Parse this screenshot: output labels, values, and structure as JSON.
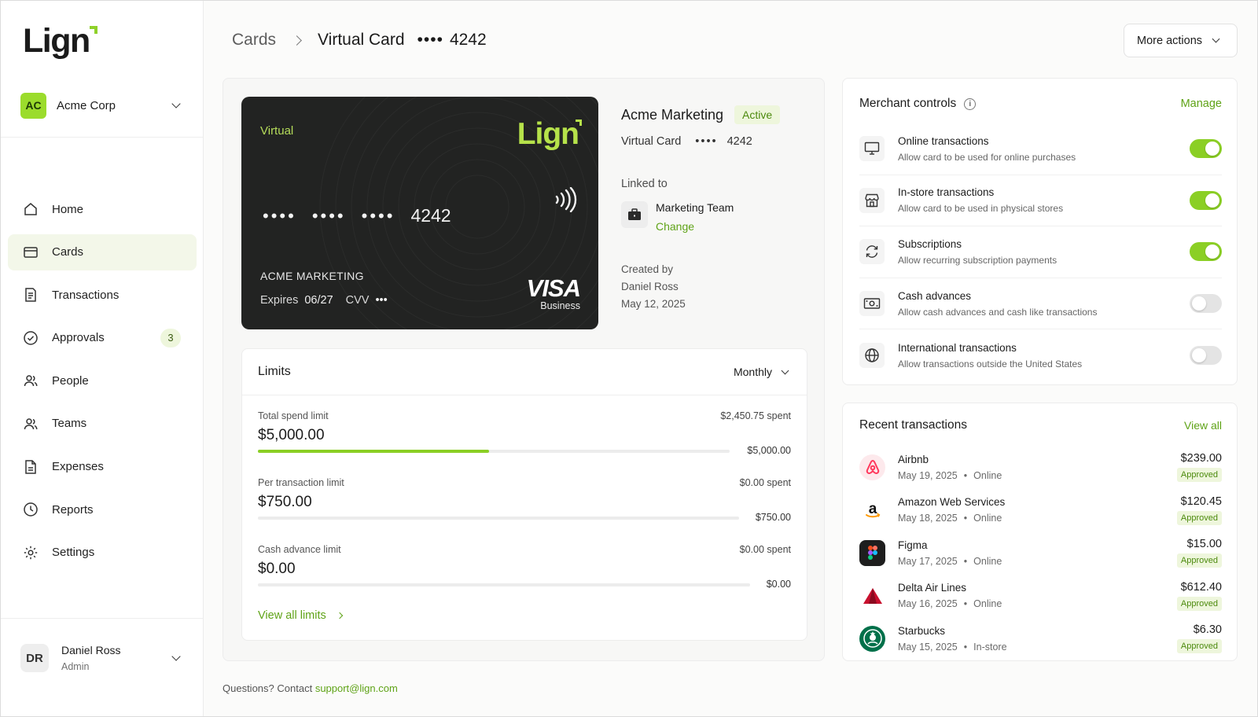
{
  "brand": {
    "name": "Lign",
    "accent": "#8bcf25"
  },
  "org": {
    "initials": "AC",
    "name": "Acme Corp"
  },
  "nav": [
    {
      "label": "Home",
      "icon": "home-icon"
    },
    {
      "label": "Cards",
      "icon": "card-icon",
      "active": true
    },
    {
      "label": "Transactions",
      "icon": "receipt-icon"
    },
    {
      "label": "Approvals",
      "icon": "check-circle-icon",
      "badge": "3"
    },
    {
      "label": "People",
      "icon": "people-icon"
    },
    {
      "label": "Teams",
      "icon": "team-icon"
    },
    {
      "label": "Expenses",
      "icon": "document-icon"
    },
    {
      "label": "Reports",
      "icon": "clock-icon"
    },
    {
      "label": "Settings",
      "icon": "gear-icon"
    }
  ],
  "user": {
    "initials": "DR",
    "name": "Daniel Ross",
    "role": "Admin"
  },
  "breadcrumb": {
    "parent": "Cards",
    "current": "Virtual Card",
    "dots": "••••",
    "last4": "4242"
  },
  "header": {
    "more_actions": "More actions"
  },
  "virtual_card": {
    "type": "Virtual",
    "brand": "Lign",
    "number_groups": [
      "••••",
      "••••",
      "••••"
    ],
    "last4": "4242",
    "holder": "ACME MARKETING",
    "expires_label": "Expires",
    "expires": "06/27",
    "cvv_label": "CVV",
    "cvv": "•••",
    "network": "VISA",
    "network_sub": "Business"
  },
  "card_info": {
    "name": "Acme Marketing",
    "status": "Active",
    "type": "Virtual Card",
    "dots": "••••",
    "last4": "4242",
    "linked_label": "Linked to",
    "team": "Marketing Team",
    "change": "Change",
    "created_label": "Created by",
    "created_by": "Daniel Ross",
    "created_date": "May 12, 2025"
  },
  "limits": {
    "title": "Limits",
    "period": "Monthly",
    "rows": [
      {
        "label": "Total spend limit",
        "spent": "$2,450.75 spent",
        "value": "$5,000.00",
        "max": "$5,000.00",
        "fraction": 0.49
      },
      {
        "label": "Per transaction limit",
        "spent": "$0.00 spent",
        "value": "$750.00",
        "max": "$750.00",
        "fraction": 0
      },
      {
        "label": "Cash advance limit",
        "spent": "$0.00 spent",
        "value": "$0.00",
        "max": "$0.00",
        "fraction": 0
      }
    ],
    "view_all": "View all limits"
  },
  "merchant_controls": {
    "title": "Merchant controls",
    "manage": "Manage",
    "items": [
      {
        "name": "Online transactions",
        "desc": "Allow card to be used for online purchases",
        "on": true,
        "icon": "monitor-icon"
      },
      {
        "name": "In-store transactions",
        "desc": "Allow card to be used in physical stores",
        "on": true,
        "icon": "store-icon"
      },
      {
        "name": "Subscriptions",
        "desc": "Allow recurring subscription payments",
        "on": true,
        "icon": "refresh-icon"
      },
      {
        "name": "Cash advances",
        "desc": "Allow cash advances and cash like transactions",
        "on": false,
        "icon": "cash-icon"
      },
      {
        "name": "International transactions",
        "desc": "Allow transactions outside the United States",
        "on": false,
        "icon": "globe-icon"
      }
    ]
  },
  "recent_transactions": {
    "title": "Recent transactions",
    "view_all": "View all",
    "items": [
      {
        "merchant": "Airbnb",
        "date": "May 19, 2025",
        "channel": "Online",
        "amount": "$239.00",
        "status": "Approved",
        "logo": "airbnb-logo-icon"
      },
      {
        "merchant": "Amazon Web Services",
        "date": "May 18, 2025",
        "channel": "Online",
        "amount": "$120.45",
        "status": "Approved",
        "logo": "amazon-logo-icon"
      },
      {
        "merchant": "Figma",
        "date": "May 17, 2025",
        "channel": "Online",
        "amount": "$15.00",
        "status": "Approved",
        "logo": "figma-logo-icon"
      },
      {
        "merchant": "Delta Air Lines",
        "date": "May 16, 2025",
        "channel": "Online",
        "amount": "$612.40",
        "status": "Approved",
        "logo": "delta-logo-icon"
      },
      {
        "merchant": "Starbucks",
        "date": "May 15, 2025",
        "channel": "In-store",
        "amount": "$6.30",
        "status": "Approved",
        "logo": "starbucks-logo-icon"
      }
    ]
  },
  "footer": {
    "text": "Questions? Contact",
    "email": "support@lign.com"
  }
}
